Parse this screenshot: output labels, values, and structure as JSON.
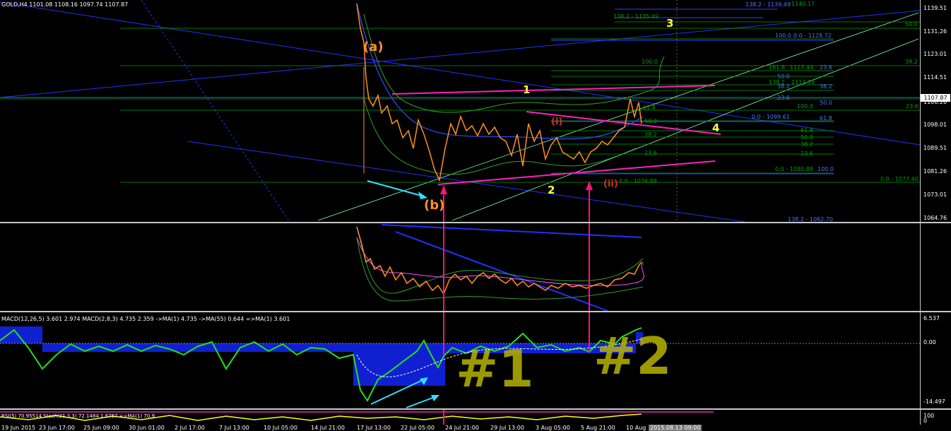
{
  "header": {
    "symbol_line": "GOLD,H4 1101.08 1108.16 1097.74 1107.87"
  },
  "price_axis": {
    "ticks": [
      "1139.51",
      "1131.26",
      "1123.01",
      "1114.51",
      "1106.26",
      "1098.01",
      "1089.51",
      "1081.26",
      "1073.01",
      "1064.76"
    ],
    "current_price": "1107.87"
  },
  "fib_labels": {
    "top_138_1135": "138.2 - 1135.49",
    "top_138_1139": "138.2 - 1139.49",
    "top_1140": "1140.17",
    "r100_0_1128": "100.0",
    "r0_1128": "0.0 - 1128.72",
    "r50_a": "50.0",
    "r38_a": "38.2",
    "r100_b": "100.0",
    "r161": "161.8",
    "r1117": "1117.44",
    "r23_a": "23.6",
    "r50_b": "50.0",
    "r138_b": "138.2",
    "r1112": "1112.18",
    "r38_b": "38.2",
    "r23_b": "23.6",
    "r50_c": "50.0",
    "r100_c": "100.0",
    "r23_c": "23.6",
    "r61_a": "61.8",
    "r0_1099": "0.0 - 1099.61",
    "r61_b": "61.8",
    "r61_c": "61.8",
    "r50_d": "50.0",
    "r38_c": "38.2",
    "r38_d": "38.2",
    "r23_d": "23.6",
    "r23_e": "23.6",
    "r0_1080": "0.0 - 1080.88",
    "r100_d": "100.0",
    "r0_1076": "0.0 - 1076.88",
    "r0_1077": "0.0 - 1077.40",
    "r138_1062": "138.2 - 1062.70",
    "r50_e": "50.0",
    "r38_e": "38.2",
    "r23_f": "23.6"
  },
  "wave_labels": {
    "a": "(a)",
    "b": "(b)",
    "one": "1",
    "two": "2",
    "three": "3",
    "four": "4",
    "i": "(i)",
    "ii": "(ii)"
  },
  "macd_pane": {
    "title": "MACD(12,26,5) 3.601 2.974  MACD(2,8,3) 4.735 2.359  ->MA(1) 4.735  ->MA(55) 0.644  =>MA(1) 3.601",
    "ticks": [
      "6.537",
      "0.00",
      "-14.497"
    ]
  },
  "stoch_pane": {
    "title": "RSI(5) 70.95514  Stoch(21,3,3) 72.1484 1.6757  =>MA(1) 70.9",
    "ticks": [
      "100",
      "0"
    ]
  },
  "time_axis": {
    "ticks": [
      "19 Jun 2015",
      "23 Jun 17:00",
      "25 Jun 09:00",
      "30 Jun 01:00",
      "2 Jul 17:00",
      "7 Jul 13:00",
      "10 Jul 05:00",
      "14 Jul 21:00",
      "17 Jul 13:00",
      "22 Jul 05:00",
      "24 Jul 21:00",
      "29 Jul 13:00",
      "3 Aug 05:00",
      "5 Aug 21:00",
      "10 Aug"
    ],
    "highlight": "2015.08.13 09:00"
  },
  "annotations": {
    "n1": "#1",
    "n2": "#2"
  },
  "colors": {
    "bg": "#000000",
    "fib": "#00a000",
    "trend_blue": "#2020ff",
    "magenta": "#ff20c0",
    "wave_yellow": "#ffff40",
    "wave_orange": "#ff9020",
    "cyan": "#30e0ff"
  }
}
